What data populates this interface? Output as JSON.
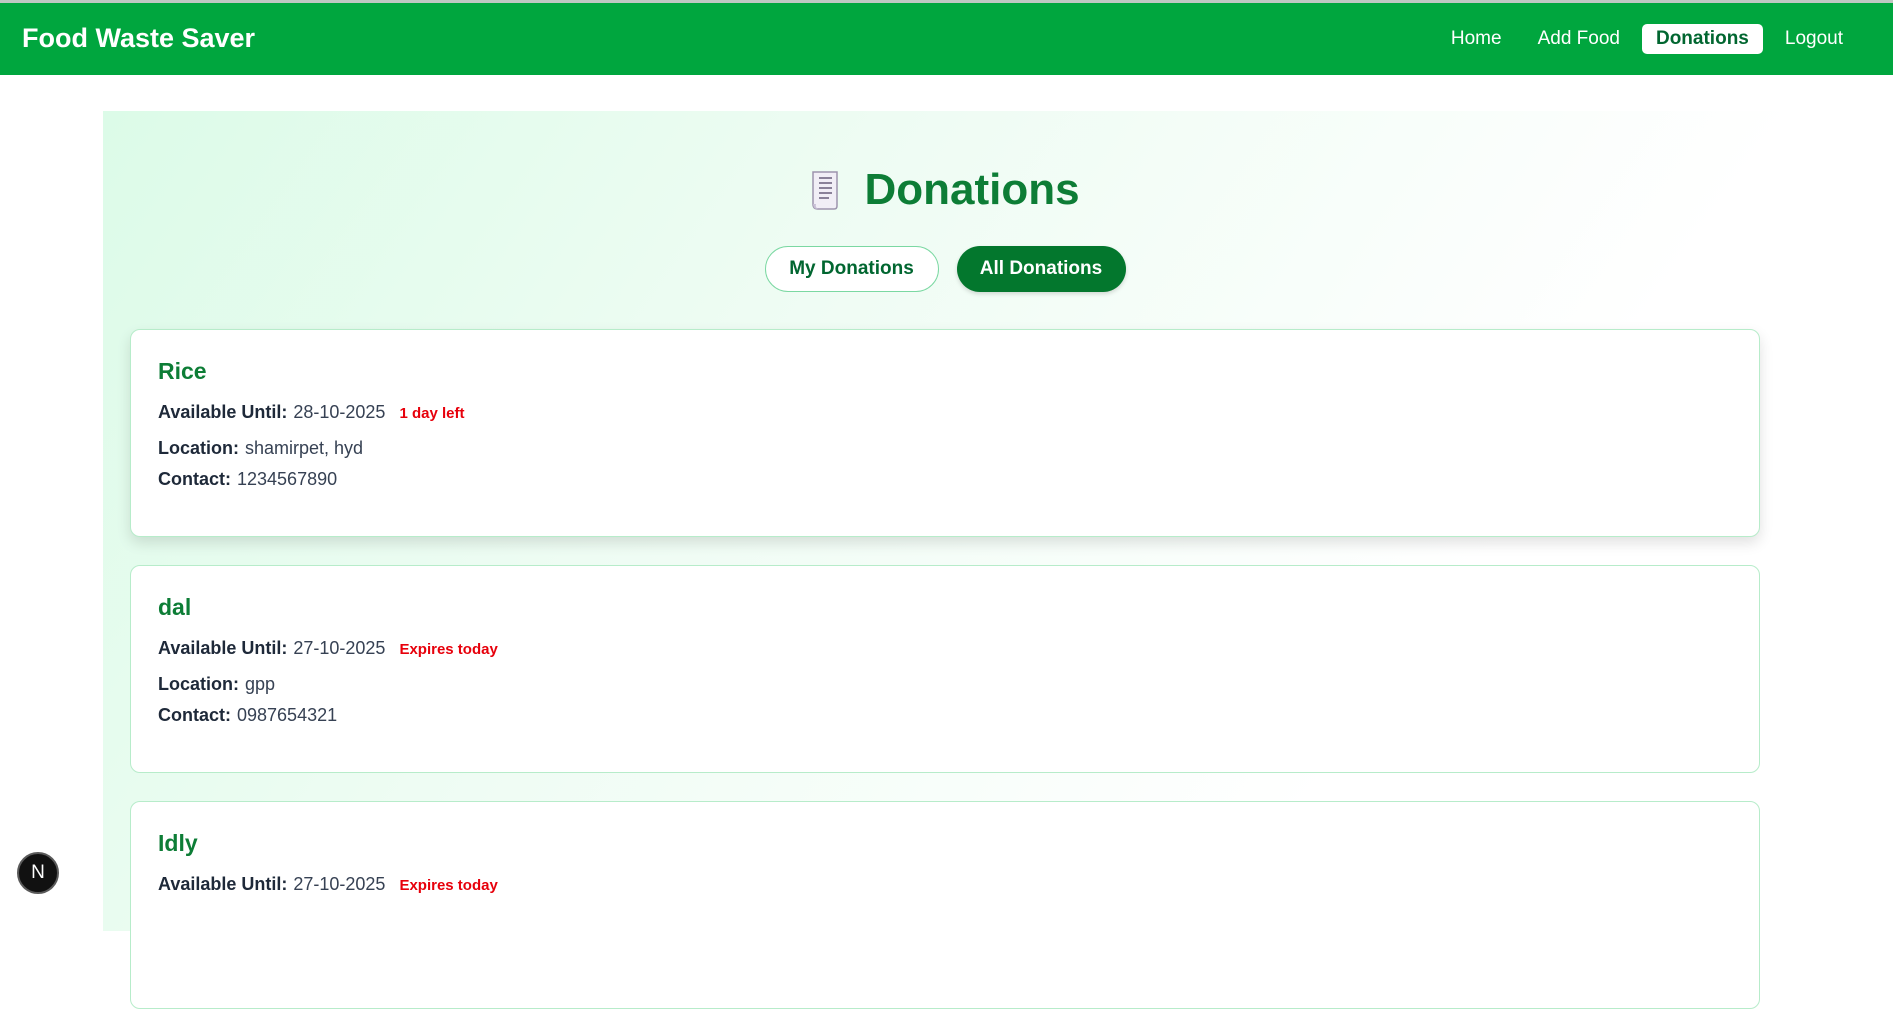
{
  "navbar": {
    "brand": "Food Waste Saver",
    "links": [
      "Home",
      "Add Food",
      "Donations",
      "Logout"
    ],
    "active": "Donations",
    "color": "#00a63e"
  },
  "page": {
    "title_icon": "receipt-icon",
    "title": "Donations",
    "tabs": [
      "My Donations",
      "All Donations"
    ],
    "active_tab": "All Donations"
  },
  "labels": {
    "available_until": "Available Until:",
    "location": "Location:",
    "contact": "Contact:"
  },
  "donations": [
    {
      "name": "Rice",
      "available_until": "28-10-2025",
      "status": "1 day left",
      "location": "shamirpet, hyd",
      "contact": "1234567890"
    },
    {
      "name": "dal",
      "available_until": "27-10-2025",
      "status": "Expires today",
      "location": "gpp",
      "contact": "0987654321"
    },
    {
      "name": "Idly",
      "available_until": "27-10-2025",
      "status": "Expires today"
    }
  ],
  "devtools": {
    "icon": "nextjs-logo-icon",
    "glyph": "N"
  },
  "colors": {
    "accent": "#0d7d36",
    "badge": "#e7000b",
    "active_tab": "#03772d"
  }
}
